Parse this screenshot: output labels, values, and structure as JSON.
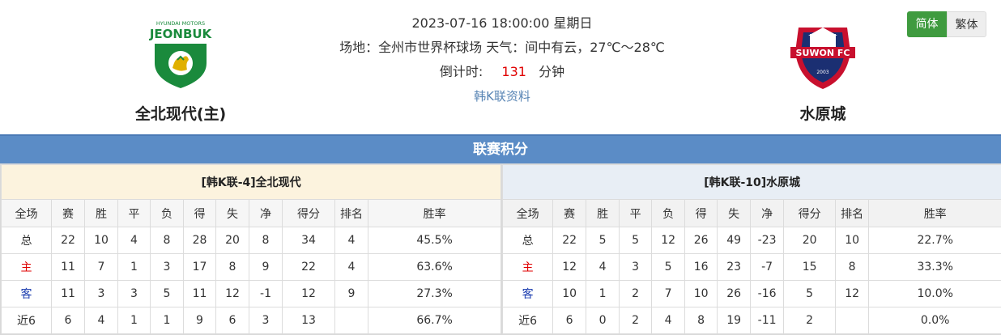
{
  "match": {
    "datetime": "2023-07-16 18:00:00 星期日",
    "venue_weather": "场地：全州市世界杯球场 天气：间中有云，27℃～28℃",
    "countdown_label": "倒计时:",
    "countdown_value": "131",
    "countdown_unit": "分钟",
    "league_link": "韩K联资料"
  },
  "home_team": {
    "name": "全北现代(主)",
    "logo_text": "JEONBUK",
    "logo_subtext": "HYUNDAI MOTORS",
    "logo_color": "#1a8a3c"
  },
  "away_team": {
    "name": "水原城",
    "logo_text": "SUWON FC",
    "logo_subtext": "2003",
    "logo_color": "#c8102e"
  },
  "lang": {
    "simplified": "简体",
    "traditional": "繁体"
  },
  "section_title": "联赛积分",
  "colors": {
    "accent_green": "#3f9b3f",
    "header_blue": "#5b8cc6",
    "home_red": "#e00000",
    "away_blue": "#1e3fb0"
  },
  "standings": {
    "columns": [
      "全场",
      "赛",
      "胜",
      "平",
      "负",
      "得",
      "失",
      "净",
      "得分",
      "排名",
      "胜率"
    ],
    "home": {
      "caption": "[韩K联-4]全北现代",
      "rows": [
        [
          "总",
          "22",
          "10",
          "4",
          "8",
          "28",
          "20",
          "8",
          "34",
          "4",
          "45.5%"
        ],
        [
          "主",
          "11",
          "7",
          "1",
          "3",
          "17",
          "8",
          "9",
          "22",
          "4",
          "63.6%"
        ],
        [
          "客",
          "11",
          "3",
          "3",
          "5",
          "11",
          "12",
          "-1",
          "12",
          "9",
          "27.3%"
        ],
        [
          "近6",
          "6",
          "4",
          "1",
          "1",
          "9",
          "6",
          "3",
          "13",
          "",
          "66.7%"
        ]
      ]
    },
    "away": {
      "caption": "[韩K联-10]水原城",
      "rows": [
        [
          "总",
          "22",
          "5",
          "5",
          "12",
          "26",
          "49",
          "-23",
          "20",
          "10",
          "22.7%"
        ],
        [
          "主",
          "12",
          "4",
          "3",
          "5",
          "16",
          "23",
          "-7",
          "15",
          "8",
          "33.3%"
        ],
        [
          "客",
          "10",
          "1",
          "2",
          "7",
          "10",
          "26",
          "-16",
          "5",
          "12",
          "10.0%"
        ],
        [
          "近6",
          "6",
          "0",
          "2",
          "4",
          "8",
          "19",
          "-11",
          "2",
          "",
          "0.0%"
        ]
      ]
    }
  }
}
